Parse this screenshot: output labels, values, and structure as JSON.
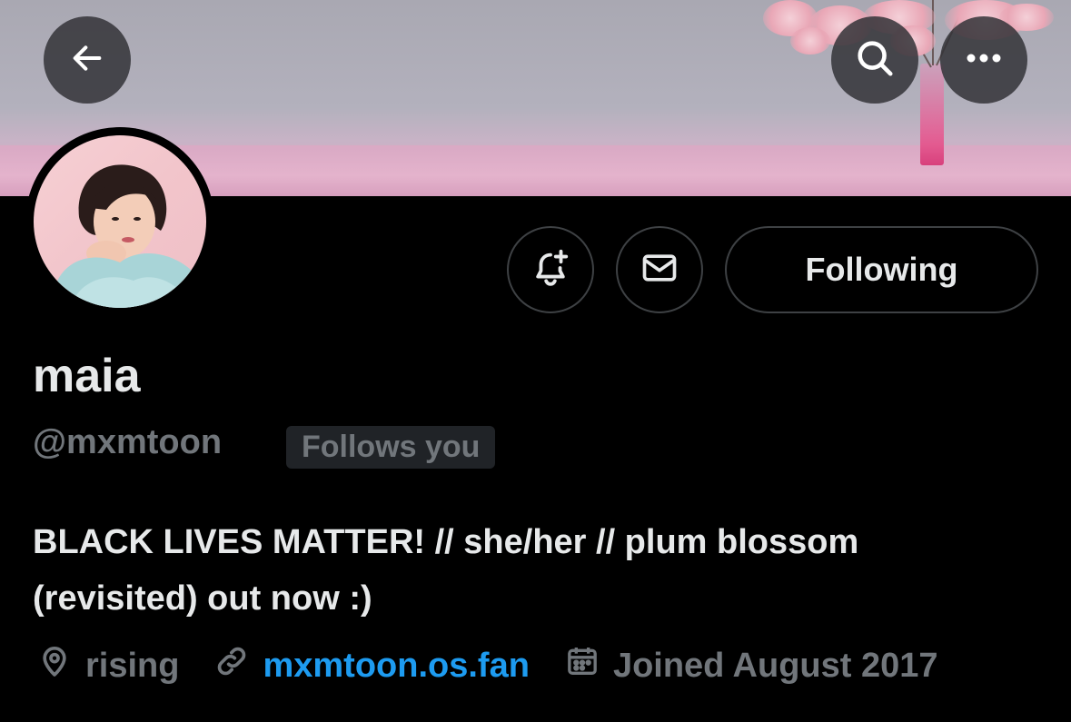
{
  "profile": {
    "name": "maia",
    "handle": "@mxmtoon",
    "follows_you": "Follows you",
    "bio_line1": "BLACK LIVES MATTER! // she/her // plum blossom",
    "bio_line2": "(revisited) out now :)",
    "location": "rising",
    "website": "mxmtoon.os.fan",
    "joined": "Joined August 2017"
  },
  "actions": {
    "following_label": "Following"
  },
  "icons": {
    "back": "back-arrow-icon",
    "search": "search-icon",
    "more": "more-horizontal-icon",
    "notify": "bell-plus-icon",
    "message": "envelope-icon",
    "location": "location-pin-icon",
    "link": "link-icon",
    "calendar": "calendar-icon"
  },
  "colors": {
    "background": "#000000",
    "text_primary": "#e7e9ea",
    "text_secondary": "#71767b",
    "link": "#1d9bf0",
    "badge_bg": "#202327",
    "button_border": "#3e4144"
  }
}
